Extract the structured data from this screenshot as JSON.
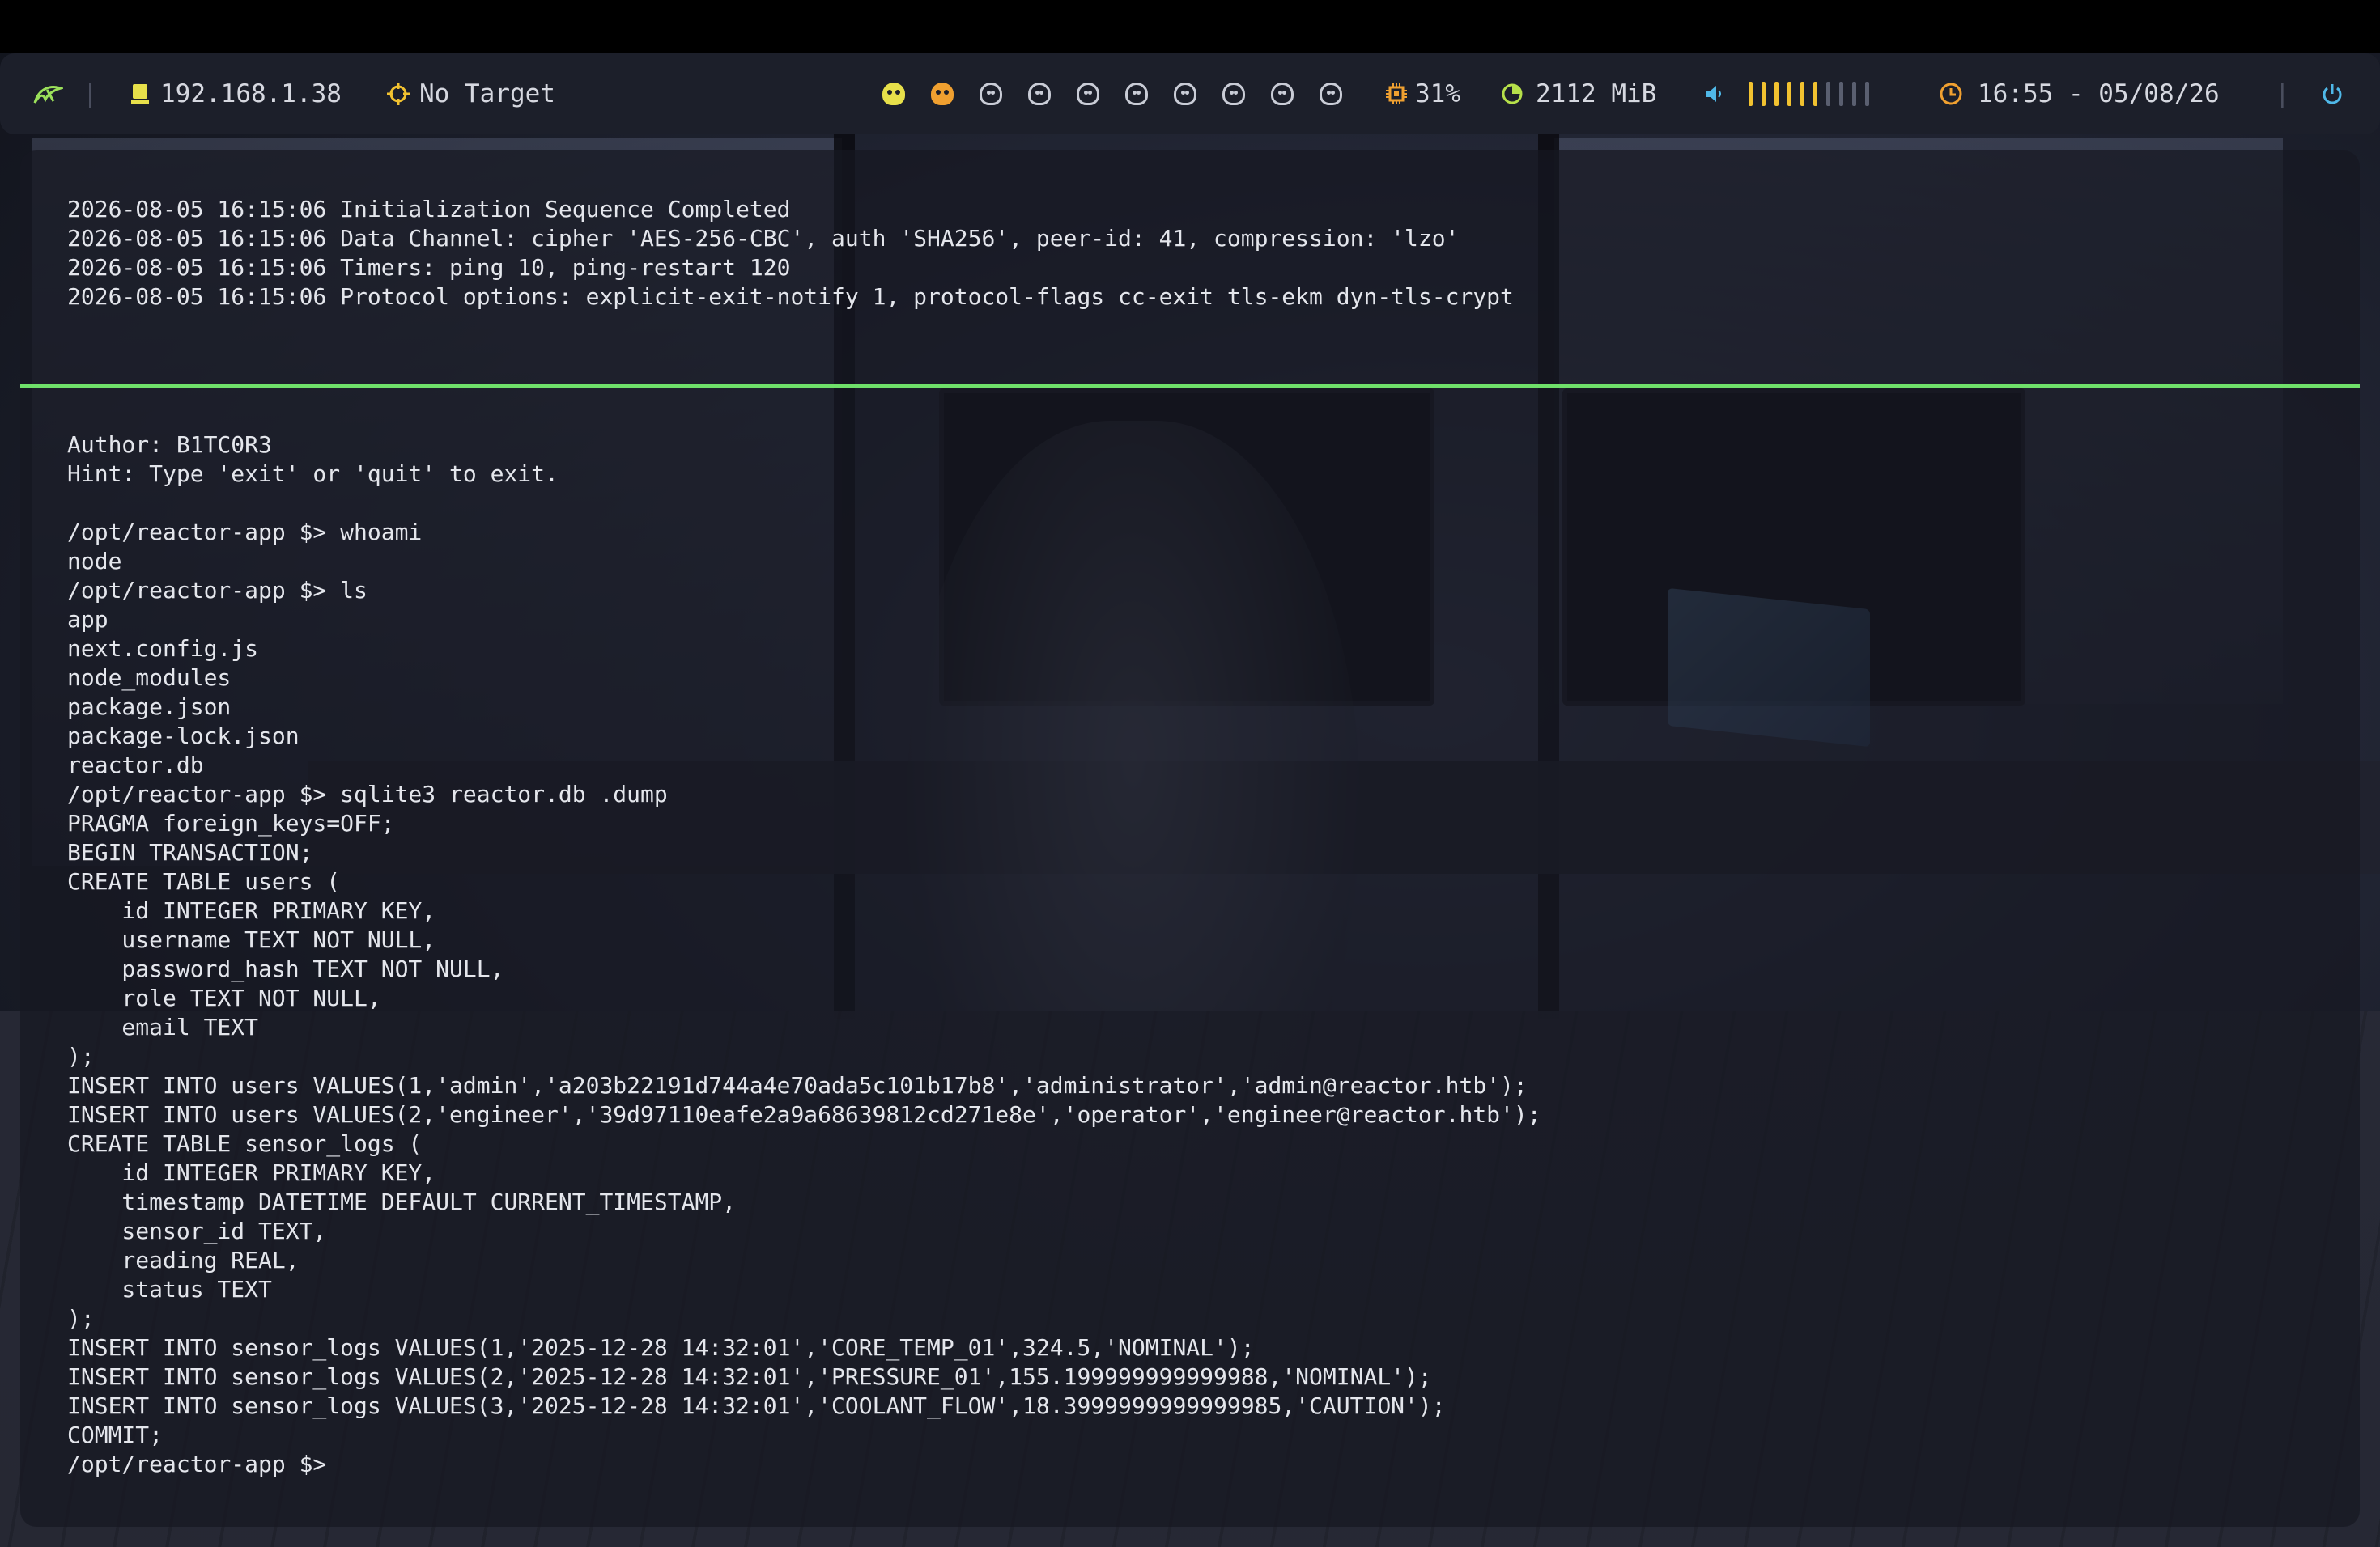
{
  "statusbar": {
    "logo_icon": "arch-leaf-icon",
    "ip_icon": "monitor-icon",
    "ip": "192.168.1.38",
    "target_icon": "crosshair-icon",
    "target": "No Target",
    "workspaces": [
      {
        "icon": "skull-icon",
        "state": "active",
        "color": "#e7e04a"
      },
      {
        "icon": "skull-icon",
        "state": "occupied",
        "color": "#f0a030"
      },
      {
        "icon": "skull-icon",
        "state": "empty"
      },
      {
        "icon": "skull-icon",
        "state": "empty"
      },
      {
        "icon": "skull-icon",
        "state": "empty"
      },
      {
        "icon": "skull-icon",
        "state": "empty"
      },
      {
        "icon": "skull-icon",
        "state": "empty"
      },
      {
        "icon": "skull-icon",
        "state": "empty"
      },
      {
        "icon": "skull-icon",
        "state": "empty"
      },
      {
        "icon": "skull-icon",
        "state": "empty"
      }
    ],
    "cpu_icon": "cpu-icon",
    "cpu": "31%",
    "memory_icon": "memory-pie-icon",
    "memory": "2112 MiB",
    "volume_icon": "speaker-icon",
    "volume_level": 0.6,
    "clock_icon": "clock-icon",
    "clock": "16:55 - 05/08/26",
    "power_icon": "power-icon",
    "colors": {
      "bar_bg": "#1c1f2a",
      "accent_green": "#6fe06a",
      "accent_yellow": "#f2c230",
      "accent_orange": "#f0a030",
      "power_blue": "#4fb8e8"
    }
  },
  "terminal_top": {
    "lines": [
      "2026-08-05 16:15:06 Initialization Sequence Completed",
      "2026-08-05 16:15:06 Data Channel: cipher 'AES-256-CBC', auth 'SHA256', peer-id: 41, compression: 'lzo'",
      "2026-08-05 16:15:06 Timers: ping 10, ping-restart 120",
      "2026-08-05 16:15:06 Protocol options: explicit-exit-notify 1, protocol-flags cc-exit tls-ekm dyn-tls-crypt"
    ]
  },
  "terminal_bottom": {
    "lines": [
      "Author: B1TC0R3",
      "Hint: Type 'exit' or 'quit' to exit.",
      "",
      "/opt/reactor-app $> whoami",
      "node",
      "/opt/reactor-app $> ls",
      "app",
      "next.config.js",
      "node_modules",
      "package.json",
      "package-lock.json",
      "reactor.db",
      "/opt/reactor-app $> sqlite3 reactor.db .dump",
      "PRAGMA foreign_keys=OFF;",
      "BEGIN TRANSACTION;",
      "CREATE TABLE users (",
      "    id INTEGER PRIMARY KEY,",
      "    username TEXT NOT NULL,",
      "    password_hash TEXT NOT NULL,",
      "    role TEXT NOT NULL,",
      "    email TEXT",
      ");",
      "INSERT INTO users VALUES(1,'admin','a203b22191d744a4e70ada5c101b17b8','administrator','admin@reactor.htb');",
      "INSERT INTO users VALUES(2,'engineer','39d97110eafe2a9a68639812cd271e8e','operator','engineer@reactor.htb');",
      "CREATE TABLE sensor_logs (",
      "    id INTEGER PRIMARY KEY,",
      "    timestamp DATETIME DEFAULT CURRENT_TIMESTAMP,",
      "    sensor_id TEXT,",
      "    reading REAL,",
      "    status TEXT",
      ");",
      "INSERT INTO sensor_logs VALUES(1,'2025-12-28 14:32:01','CORE_TEMP_01',324.5,'NOMINAL');",
      "INSERT INTO sensor_logs VALUES(2,'2025-12-28 14:32:01','PRESSURE_01',155.199999999999988,'NOMINAL');",
      "INSERT INTO sensor_logs VALUES(3,'2025-12-28 14:32:01','COOLANT_FLOW',18.3999999999999985,'CAUTION');",
      "COMMIT;",
      "/opt/reactor-app $> "
    ]
  }
}
